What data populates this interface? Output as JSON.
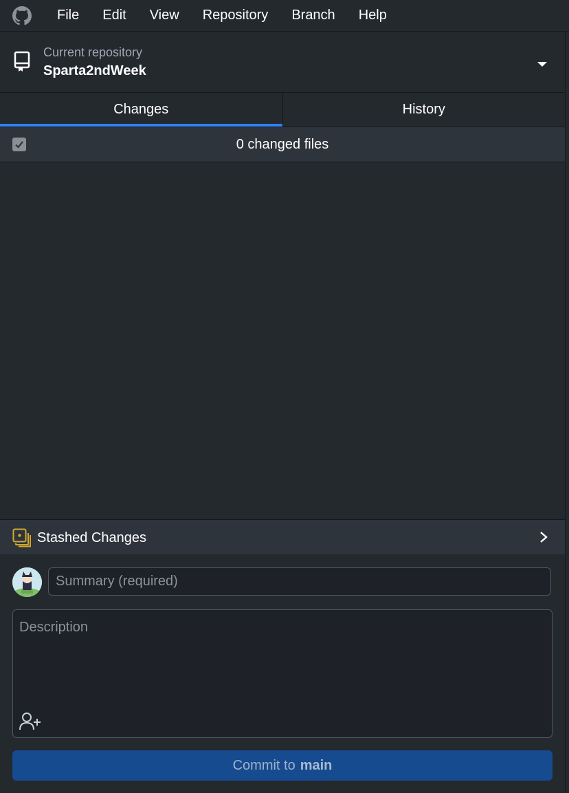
{
  "menu": {
    "items": [
      "File",
      "Edit",
      "View",
      "Repository",
      "Branch",
      "Help"
    ]
  },
  "repository": {
    "label": "Current repository",
    "name": "Sparta2ndWeek"
  },
  "tabs": [
    {
      "label": "Changes",
      "active": true
    },
    {
      "label": "History",
      "active": false
    }
  ],
  "changes": {
    "count_label": "0 changed files",
    "select_all_checked": true
  },
  "stash": {
    "label": "Stashed Changes"
  },
  "commit": {
    "summary_placeholder": "Summary (required)",
    "description_placeholder": "Description",
    "button_prefix": "Commit to",
    "branch": "main"
  },
  "colors": {
    "background": "#24292e",
    "accent": "#2f81f7",
    "stash_icon": "#d4a72c",
    "commit_button": "#174b8f"
  },
  "icons": [
    "github-logo-icon",
    "repository-icon",
    "caret-down-icon",
    "checkbox-icon",
    "stash-icon",
    "chevron-right-icon",
    "avatar",
    "add-coauthor-icon"
  ]
}
